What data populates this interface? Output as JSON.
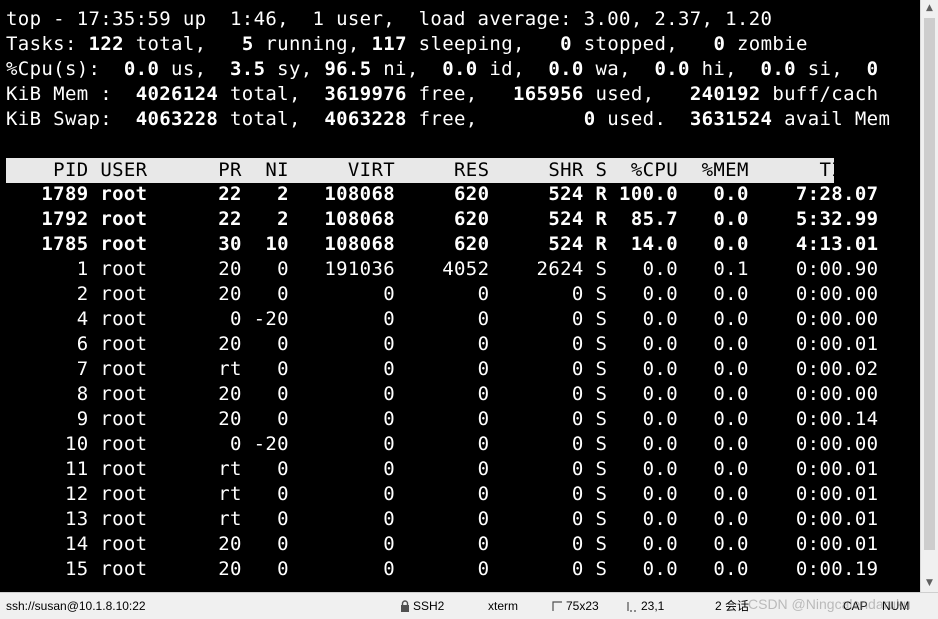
{
  "summary": {
    "line1": "top - 17:35:59 up  1:46,  1 user,  load average: 3.00, 2.37, 1.20",
    "tasks": {
      "label": "Tasks:",
      "total": "122",
      "total_label": " total,",
      "running": "5",
      "running_label": " running,",
      "sleeping": "117",
      "sleeping_label": " sleeping,",
      "stopped": "0",
      "stopped_label": " stopped,",
      "zombie": "0",
      "zombie_label": " zombie"
    },
    "cpu": {
      "label": "%Cpu(s):",
      "us": "0.0",
      "us_label": " us,",
      "sy": "3.5",
      "sy_label": " sy,",
      "ni": "96.5",
      "ni_label": " ni,",
      "id": "0.0",
      "id_label": " id,",
      "wa": "0.0",
      "wa_label": " wa,",
      "hi": "0.0",
      "hi_label": " hi,",
      "si": "0.0",
      "si_label": " si,",
      "st": "0"
    },
    "mem": {
      "label": "KiB Mem :",
      "total": "4026124",
      "total_label": " total,",
      "free": "3619976",
      "free_label": " free,",
      "used": "165956",
      "used_label": " used,",
      "buff": "240192",
      "buff_label": " buff/cach"
    },
    "swap": {
      "label": "KiB Swap:",
      "total": "4063228",
      "total_label": " total,",
      "free": "4063228",
      "free_label": " free,",
      "used": "0",
      "used_label": " used.",
      "avail": "3631524",
      "avail_label": " avail Mem"
    }
  },
  "table": {
    "columns": [
      "PID",
      "USER",
      "PR",
      "NI",
      "VIRT",
      "RES",
      "SHR",
      "S",
      "%CPU",
      "%MEM",
      "TIME+"
    ],
    "rows": [
      {
        "pid": "1789",
        "user": "root",
        "pr": "22",
        "ni": "2",
        "virt": "108068",
        "res": "620",
        "shr": "524",
        "s": "R",
        "cpu": "100.0",
        "mem": "0.0",
        "time": "7:28.07",
        "active": true
      },
      {
        "pid": "1792",
        "user": "root",
        "pr": "22",
        "ni": "2",
        "virt": "108068",
        "res": "620",
        "shr": "524",
        "s": "R",
        "cpu": "85.7",
        "mem": "0.0",
        "time": "5:32.99",
        "active": true
      },
      {
        "pid": "1785",
        "user": "root",
        "pr": "30",
        "ni": "10",
        "virt": "108068",
        "res": "620",
        "shr": "524",
        "s": "R",
        "cpu": "14.0",
        "mem": "0.0",
        "time": "4:13.01",
        "active": true
      },
      {
        "pid": "1",
        "user": "root",
        "pr": "20",
        "ni": "0",
        "virt": "191036",
        "res": "4052",
        "shr": "2624",
        "s": "S",
        "cpu": "0.0",
        "mem": "0.1",
        "time": "0:00.90",
        "active": false
      },
      {
        "pid": "2",
        "user": "root",
        "pr": "20",
        "ni": "0",
        "virt": "0",
        "res": "0",
        "shr": "0",
        "s": "S",
        "cpu": "0.0",
        "mem": "0.0",
        "time": "0:00.00",
        "active": false
      },
      {
        "pid": "4",
        "user": "root",
        "pr": "0",
        "ni": "-20",
        "virt": "0",
        "res": "0",
        "shr": "0",
        "s": "S",
        "cpu": "0.0",
        "mem": "0.0",
        "time": "0:00.00",
        "active": false
      },
      {
        "pid": "6",
        "user": "root",
        "pr": "20",
        "ni": "0",
        "virt": "0",
        "res": "0",
        "shr": "0",
        "s": "S",
        "cpu": "0.0",
        "mem": "0.0",
        "time": "0:00.01",
        "active": false
      },
      {
        "pid": "7",
        "user": "root",
        "pr": "rt",
        "ni": "0",
        "virt": "0",
        "res": "0",
        "shr": "0",
        "s": "S",
        "cpu": "0.0",
        "mem": "0.0",
        "time": "0:00.02",
        "active": false
      },
      {
        "pid": "8",
        "user": "root",
        "pr": "20",
        "ni": "0",
        "virt": "0",
        "res": "0",
        "shr": "0",
        "s": "S",
        "cpu": "0.0",
        "mem": "0.0",
        "time": "0:00.00",
        "active": false
      },
      {
        "pid": "9",
        "user": "root",
        "pr": "20",
        "ni": "0",
        "virt": "0",
        "res": "0",
        "shr": "0",
        "s": "S",
        "cpu": "0.0",
        "mem": "0.0",
        "time": "0:00.14",
        "active": false
      },
      {
        "pid": "10",
        "user": "root",
        "pr": "0",
        "ni": "-20",
        "virt": "0",
        "res": "0",
        "shr": "0",
        "s": "S",
        "cpu": "0.0",
        "mem": "0.0",
        "time": "0:00.00",
        "active": false
      },
      {
        "pid": "11",
        "user": "root",
        "pr": "rt",
        "ni": "0",
        "virt": "0",
        "res": "0",
        "shr": "0",
        "s": "S",
        "cpu": "0.0",
        "mem": "0.0",
        "time": "0:00.01",
        "active": false
      },
      {
        "pid": "12",
        "user": "root",
        "pr": "rt",
        "ni": "0",
        "virt": "0",
        "res": "0",
        "shr": "0",
        "s": "S",
        "cpu": "0.0",
        "mem": "0.0",
        "time": "0:00.01",
        "active": false
      },
      {
        "pid": "13",
        "user": "root",
        "pr": "rt",
        "ni": "0",
        "virt": "0",
        "res": "0",
        "shr": "0",
        "s": "S",
        "cpu": "0.0",
        "mem": "0.0",
        "time": "0:00.01",
        "active": false
      },
      {
        "pid": "14",
        "user": "root",
        "pr": "20",
        "ni": "0",
        "virt": "0",
        "res": "0",
        "shr": "0",
        "s": "S",
        "cpu": "0.0",
        "mem": "0.0",
        "time": "0:00.01",
        "active": false
      },
      {
        "pid": "15",
        "user": "root",
        "pr": "20",
        "ni": "0",
        "virt": "0",
        "res": "0",
        "shr": "0",
        "s": "S",
        "cpu": "0.0",
        "mem": "0.0",
        "time": "0:00.19",
        "active": false
      }
    ]
  },
  "statusbar": {
    "connection": "ssh://susan@10.1.8.10:22",
    "protocol": "SSH2",
    "terminal_type": "xterm",
    "size": "75x23",
    "cursor_pos": "23,1",
    "sessions": "2 会话",
    "caps": "CAP",
    "num": "NUM",
    "watermark": "CSDN @Ningcalendaruku"
  },
  "icons": {
    "lock": "lock-icon",
    "resize": "resize-icon",
    "cursor": "cursor-position-icon",
    "scroll_up": "scroll-up-arrow-icon",
    "scroll_down": "scroll-down-arrow-icon"
  }
}
